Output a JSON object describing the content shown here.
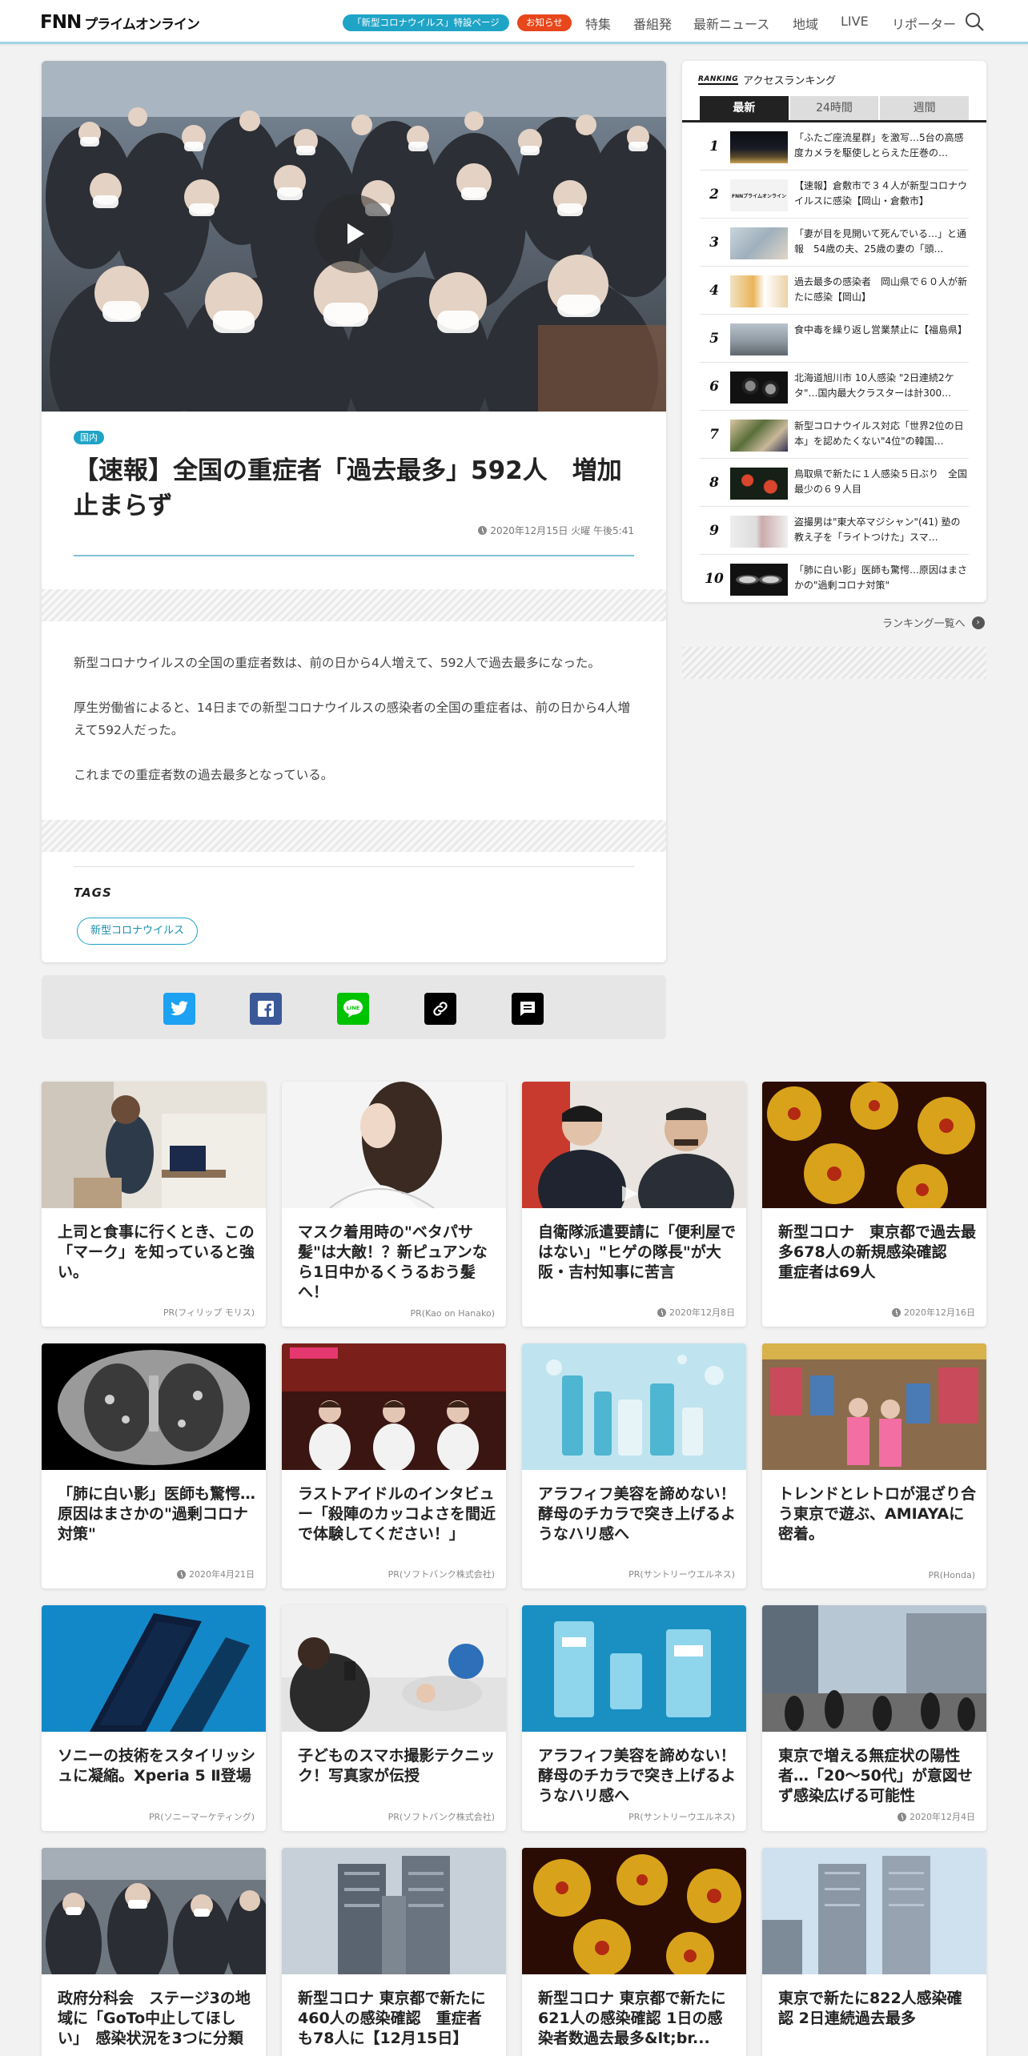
{
  "header": {
    "logo_fnn": "FNN",
    "logo_sub": "プライムオンライン",
    "covid_pill": "「新型コロナウイルス」特設ページ",
    "notice_pill": "お知らせ",
    "nav": [
      "特集",
      "番組発",
      "最新ニュース",
      "地域",
      "LIVE",
      "リポーター"
    ]
  },
  "article": {
    "category": "国内",
    "title": "【速報】全国の重症者「過去最多」592人　増加止まらず",
    "date": "2020年12月15日 火曜 午後5:41",
    "paragraphs": [
      "新型コロナウイルスの全国の重症者数は、前の日から4人増えて、592人で過去最多になった。",
      "厚生労働省によると、14日までの新型コロナウイルスの感染者の全国の重症者は、前の日から4人増えて592人だった。",
      "これまでの重症者数の過去最多となっている。"
    ],
    "tags_title": "TAGS",
    "tags": [
      "新型コロナウイルス"
    ]
  },
  "share": {
    "icons": [
      "twitter-icon",
      "facebook-icon",
      "line-icon",
      "link-icon",
      "comment-icon"
    ],
    "line_label": "LINE"
  },
  "ranking": {
    "head_tag": "RANKING",
    "title": "アクセスランキング",
    "tabs": [
      "最新",
      "24時間",
      "週間"
    ],
    "items": [
      {
        "rank": "1",
        "text": "「ふたご座流星群」を激写…5台の高感度カメラを駆使しとらえた圧巻の…"
      },
      {
        "rank": "2",
        "text": "【速報】倉敷市で３４人が新型コロナウイルスに感染【岡山・倉敷市】"
      },
      {
        "rank": "3",
        "text": "「妻が目を見開いて死んでいる…」と通報　54歳の夫、25歳の妻の「頭…"
      },
      {
        "rank": "4",
        "text": "過去最多の感染者　岡山県で６０人が新たに感染【岡山】"
      },
      {
        "rank": "5",
        "text": "食中毒を繰り返し営業禁止に【福島県】"
      },
      {
        "rank": "6",
        "text": "北海道旭川市 10人感染 \"2日連続2ケタ\"…国内最大クラスターは計300…"
      },
      {
        "rank": "7",
        "text": "新型コロナウイルス対応「世界2位の日本」を認めたくない\"4位\"の韓国…"
      },
      {
        "rank": "8",
        "text": "鳥取県で新たに１人感染５日ぶり　全国最少の６９人目"
      },
      {
        "rank": "9",
        "text": "盗撮男は\"東大卒マジシャン\"(41) 塾の教え子を「ライトつけた」スマ…"
      },
      {
        "rank": "10",
        "text": "「肺に白い影」医師も驚愕…原因はまさかの\"過剰コロナ対策\""
      }
    ],
    "thumb_logo_text": "FNNプライムオンライン",
    "more": "ランキング一覧へ"
  },
  "cards": [
    {
      "title": "上司と食事に行くとき、この「マーク」を知っていると強い。",
      "meta": "PR(フィリップ モリス)",
      "has_clock": false
    },
    {
      "title": "マスク着用時の\"ベタパサ髪\"は大敵！？新ピュアンなら1日中かるくうるおう髪へ！",
      "meta": "PR(Kao on Hanako)",
      "has_clock": false
    },
    {
      "title": "自衛隊派遣要請に「便利屋ではない」\"ヒゲの隊長\"が大阪・吉村知事に苦言",
      "meta": "2020年12月8日",
      "has_clock": true
    },
    {
      "title": "新型コロナ　東京都で過去最多678人の新規感染確認　重症者は69人",
      "meta": "2020年12月16日",
      "has_clock": true
    },
    {
      "title": "「肺に白い影」医師も驚愕…原因はまさかの\"過剰コロナ対策\"",
      "meta": "2020年4月21日",
      "has_clock": true
    },
    {
      "title": "ラストアイドルのインタビュー「殺陣のカッコよさを間近で体験してください！」",
      "meta": "PR(ソフトバンク株式会社)",
      "has_clock": false
    },
    {
      "title": "アラフィフ美容を諦めない！酵母のチカラで突き上げるようなハリ感へ",
      "meta": "PR(サントリーウエルネス)",
      "has_clock": false
    },
    {
      "title": "トレンドとレトロが混ざり合う東京で遊ぶ、AMIAYAに密着。",
      "meta": "PR(Honda)",
      "has_clock": false
    },
    {
      "title": "ソニーの技術をスタイリッシュに凝縮。Xperia 5 Ⅱ登場",
      "meta": "PR(ソニーマーケティング)",
      "has_clock": false
    },
    {
      "title": "子どものスマホ撮影テクニック！写真家が伝授",
      "meta": "PR(ソフトバンク株式会社)",
      "has_clock": false
    },
    {
      "title": "アラフィフ美容を諦めない！酵母のチカラで突き上げるようなハリ感へ",
      "meta": "PR(サントリーウエルネス)",
      "has_clock": false
    },
    {
      "title": "東京で増える無症状の陽性者…「20～50代」が意図せず感染広げる可能性",
      "meta": "2020年12月4日",
      "has_clock": true
    },
    {
      "title": "政府分科会　ステージ3の地域に「GoTo中止してほしい」　感染状況を3つに分類",
      "meta": "",
      "has_clock": false
    },
    {
      "title": "新型コロナ 東京都で新たに460人の感染確認　重症者も78人に【12月15日】",
      "meta": "",
      "has_clock": false
    },
    {
      "title": "新型コロナ 東京都で新たに621人の感染確認 1日の感染者数過去最多&lt;br...",
      "meta": "",
      "has_clock": false
    },
    {
      "title": "東京で新たに822人感染確認 2日連続過去最多",
      "meta": "",
      "has_clock": false
    }
  ]
}
